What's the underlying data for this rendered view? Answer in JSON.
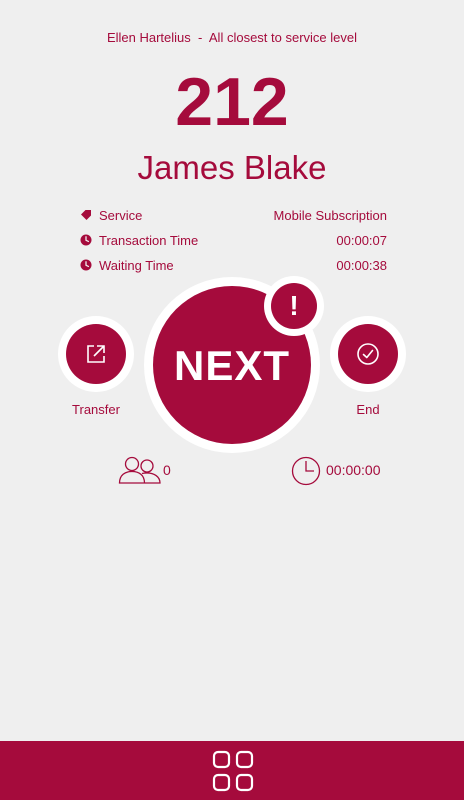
{
  "header": {
    "agent_name": "Ellen Hartelius",
    "separator": "-",
    "status": "All closest to service level"
  },
  "ticket": {
    "number": "212",
    "customer_name": "James Blake"
  },
  "details": [
    {
      "icon": "tag-icon",
      "label": "Service",
      "value": "Mobile Subscription"
    },
    {
      "icon": "clock-icon",
      "label": "Transaction Time",
      "value": "00:00:07"
    },
    {
      "icon": "clock-icon",
      "label": "Waiting Time",
      "value": "00:00:38"
    }
  ],
  "actions": {
    "transfer_label": "Transfer",
    "next_label": "NEXT",
    "alert_symbol": "!",
    "end_label": "End"
  },
  "stats": {
    "queue_count": "0",
    "wait_timer": "00:00:00"
  },
  "colors": {
    "accent": "#a50b3c",
    "background": "#efefef"
  }
}
